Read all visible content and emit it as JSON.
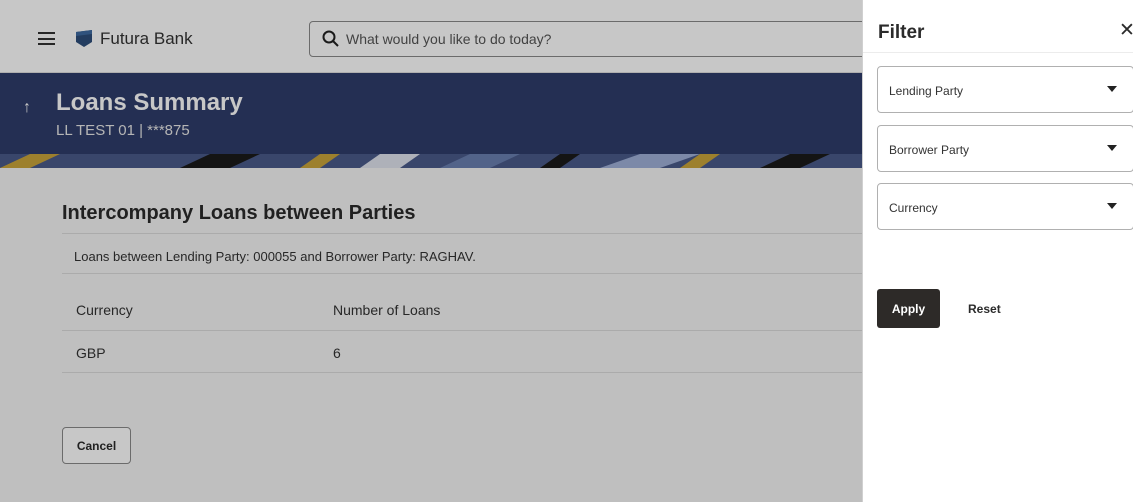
{
  "header": {
    "brand": "Futura Bank",
    "search_placeholder": "What would you like to do today?"
  },
  "banner": {
    "title": "Loans Summary",
    "subtitle": "LL TEST 01 | ***875"
  },
  "section": {
    "title": "Intercompany Loans between Parties",
    "description": "Loans between Lending Party: 000055 and Borrower Party: RAGHAV.",
    "columns": [
      "Currency",
      "Number of Loans"
    ],
    "rows": [
      [
        "GBP",
        "6"
      ]
    ],
    "cancel_label": "Cancel"
  },
  "filter": {
    "title": "Filter",
    "close_icon": "close-icon",
    "lending_party": "Lending Party",
    "borrower_party": "Borrower Party",
    "currency": "Currency",
    "apply_label": "Apply",
    "reset_label": "Reset"
  },
  "colors": {
    "banner": "#2f3d6b",
    "apply_button": "#2d2a28",
    "logo": "#2d4e7a"
  }
}
